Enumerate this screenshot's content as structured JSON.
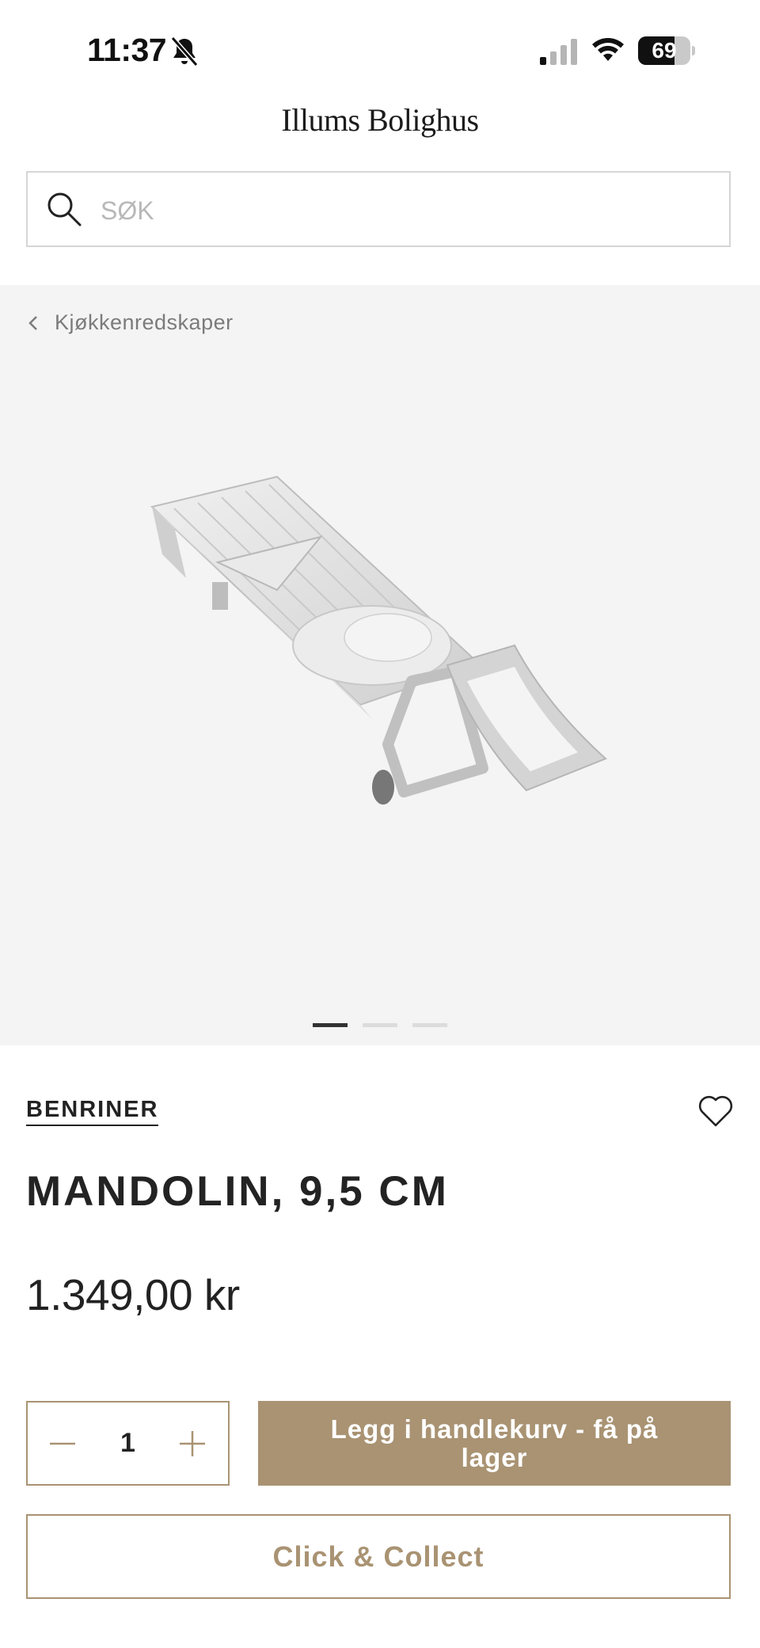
{
  "status_bar": {
    "time": "11:37",
    "battery_percent": "69",
    "battery_level": 0.69,
    "icons": [
      "bell-slash-icon",
      "cellular-signal-icon",
      "wifi-icon",
      "battery-icon"
    ]
  },
  "header": {
    "logo": "Illums Bolighus",
    "search": {
      "placeholder": "SØK",
      "value": ""
    }
  },
  "gallery": {
    "breadcrumb": "Kjøkkenredskaper",
    "image_alt": "Mandolin",
    "slide_count": 3,
    "active_slide": 1
  },
  "product": {
    "brand": "BENRINER",
    "title": "MANDOLIN, 9,5 CM",
    "price": "1.349,00 kr",
    "quantity": "1",
    "add_to_cart_label": "Legg i handlekurv - få på lager",
    "click_collect_label": "Click & Collect"
  },
  "colors": {
    "accent": "#a99373",
    "gallery_bg": "#f4f4f4",
    "text": "#222222"
  }
}
